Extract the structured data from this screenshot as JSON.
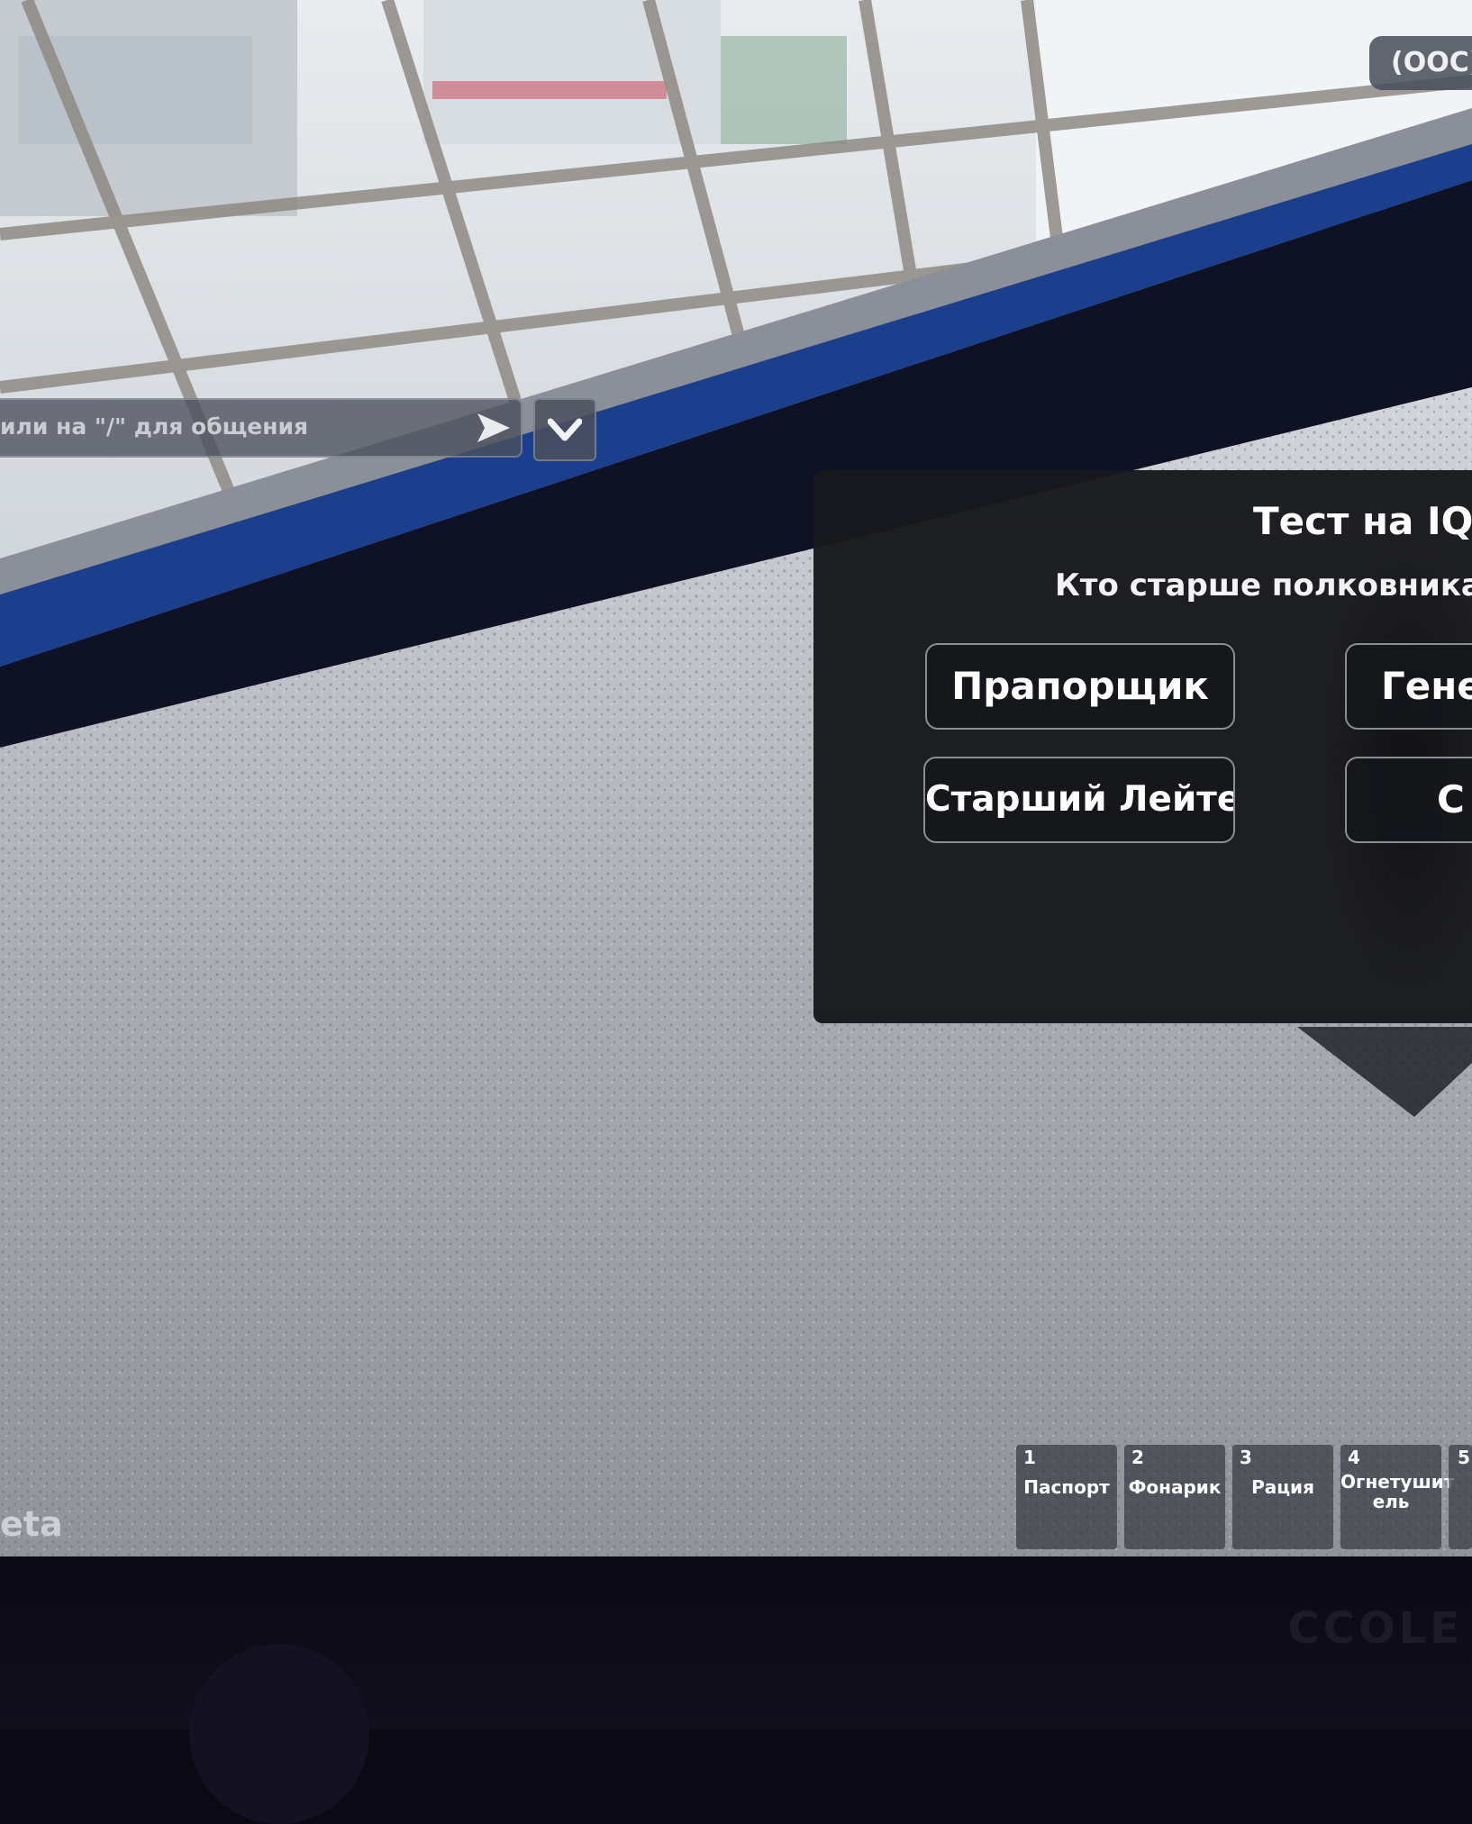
{
  "chat": {
    "hint": "или на \"/\" для общения",
    "send_icon": "send-arrow-icon",
    "toggle_icon": "chevron-down-icon"
  },
  "ooc": {
    "label": "(OOC)"
  },
  "iq_test": {
    "title": "Тест на IQ",
    "question": "Кто старше полковника по",
    "answers": [
      "Прапорщик",
      "Гене",
      "Старший Лейтенант",
      "С"
    ]
  },
  "hotbar": {
    "slots": [
      {
        "number": "1",
        "label": "Паспорт"
      },
      {
        "number": "2",
        "label": "Фонарик"
      },
      {
        "number": "3",
        "label": "Рация"
      },
      {
        "number": "4",
        "label": "Огнетушит ель"
      },
      {
        "number": "5",
        "label": ""
      }
    ]
  },
  "beta_label": "eta",
  "colors": {
    "panel_bg": "#18191d",
    "button_border": "#8a8d94",
    "wall_blue": "#1b3f8c"
  }
}
